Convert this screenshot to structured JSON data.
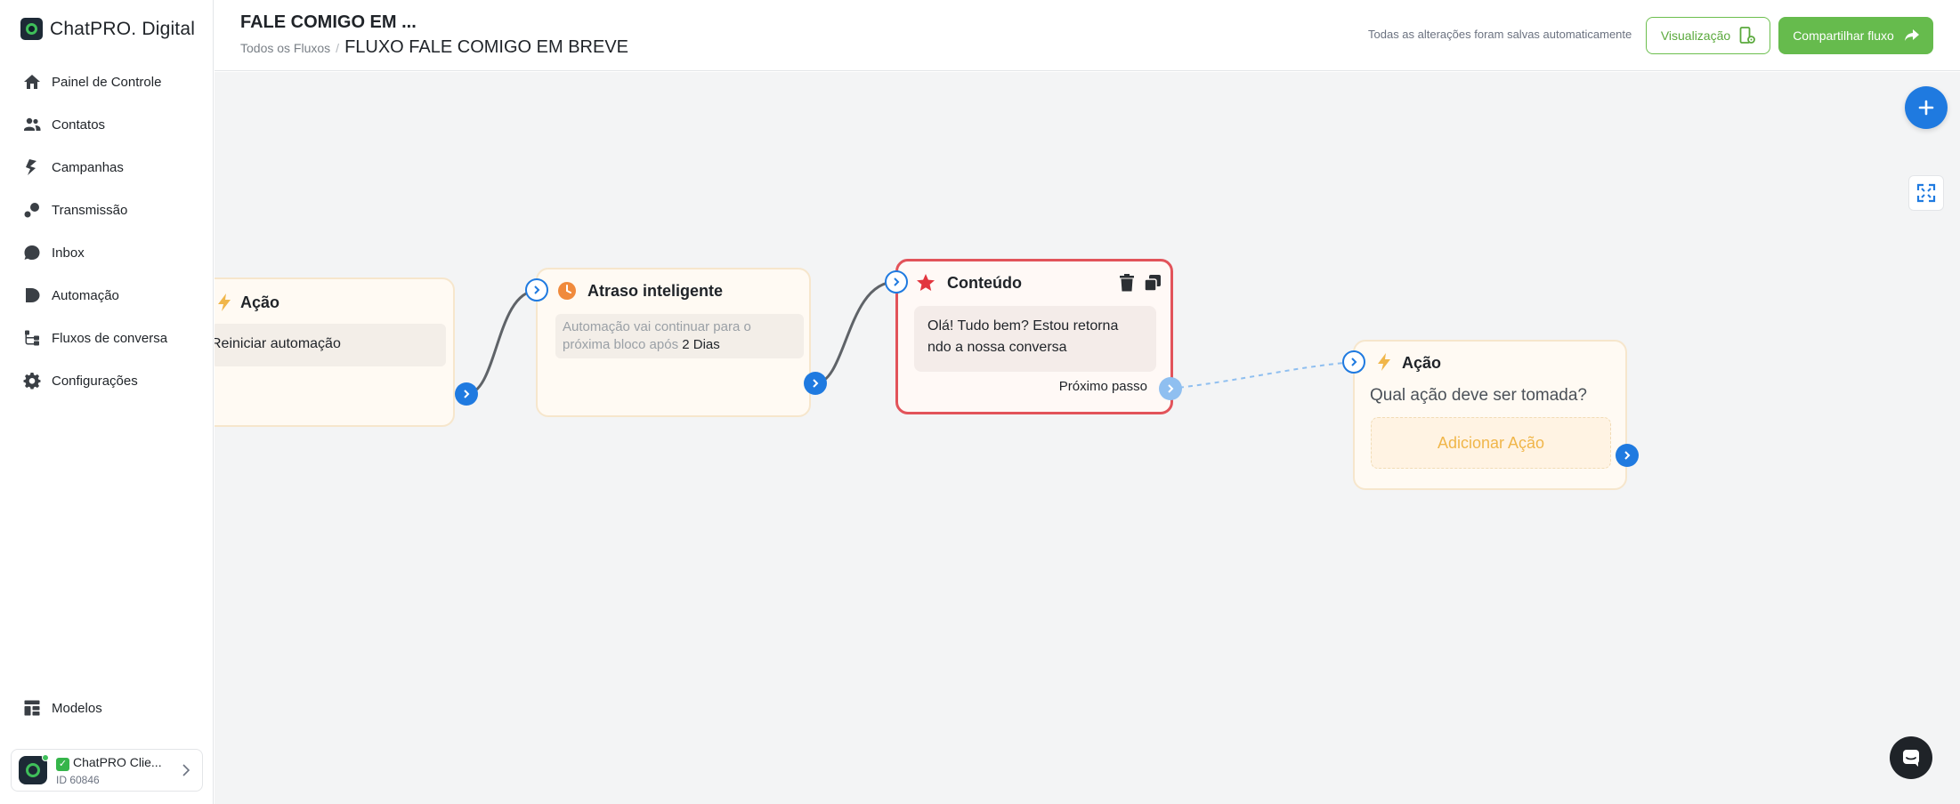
{
  "brand": {
    "name": "ChatPRO. Digital"
  },
  "sidebar": {
    "items": [
      {
        "label": "Painel de Controle",
        "icon": "home-icon"
      },
      {
        "label": "Contatos",
        "icon": "users-icon"
      },
      {
        "label": "Campanhas",
        "icon": "campaign-icon"
      },
      {
        "label": "Transmissão",
        "icon": "broadcast-icon"
      },
      {
        "label": "Inbox",
        "icon": "chat-icon"
      },
      {
        "label": "Automação",
        "icon": "automation-icon"
      },
      {
        "label": "Fluxos de conversa",
        "icon": "flow-icon"
      },
      {
        "label": "Configurações",
        "icon": "gear-icon"
      }
    ],
    "bottom": {
      "label": "Modelos",
      "icon": "templates-icon"
    },
    "account": {
      "name": "ChatPRO Clie...",
      "id": "ID 60846"
    }
  },
  "header": {
    "title": "FALE COMIGO EM ...",
    "breadcrumb_root": "Todos os Fluxos",
    "breadcrumb_sep": "/",
    "breadcrumb_current": "FLUXO FALE COMIGO EM BREVE",
    "saved_status": "Todas as alterações foram salvas automaticamente",
    "preview_label": "Visualização",
    "share_label": "Compartilhar fluxo"
  },
  "nodes": {
    "action1": {
      "title": "Ação",
      "value": "Reiniciar automação"
    },
    "delay": {
      "title": "Atraso inteligente",
      "text": "Automação vai continuar para o próxima bloco após",
      "value": "2 Dias"
    },
    "content": {
      "title": "Conteúdo",
      "message": "Olá! Tudo bem? Estou retorna ndo a nossa conversa",
      "next_label": "Próximo passo"
    },
    "action2": {
      "title": "Ação",
      "question": "Qual ação deve ser tomada?",
      "add_label": "Adicionar Ação"
    }
  },
  "colors": {
    "primary": "#1f7ae0",
    "green": "#66bb4d",
    "selected_border": "#e2535a",
    "action_yellow": "#f0b64a"
  }
}
